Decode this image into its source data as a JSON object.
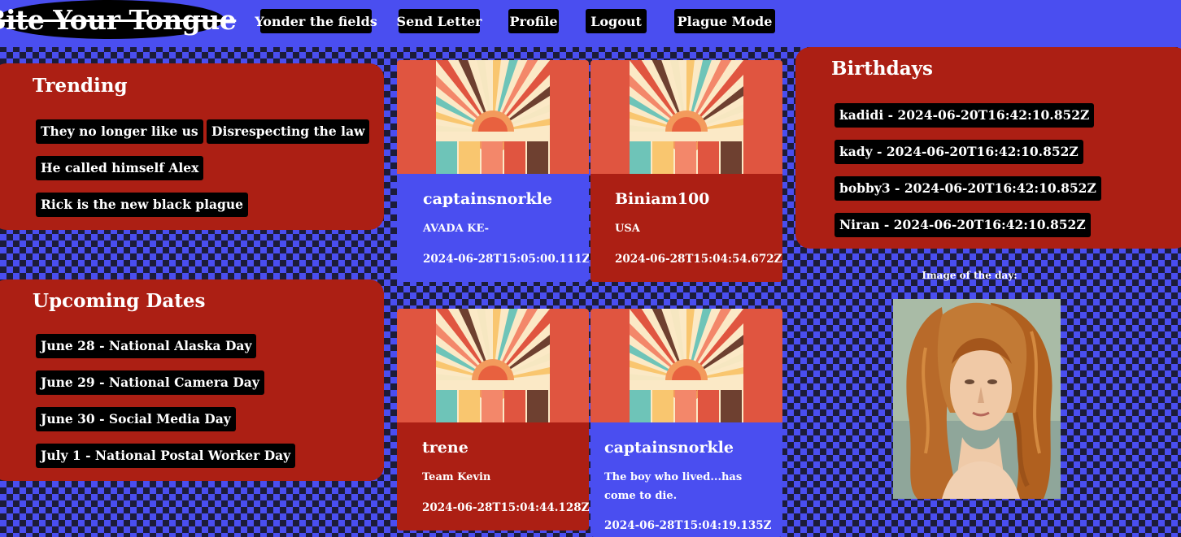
{
  "app": {
    "logo": "Bite Your Tongue"
  },
  "nav": {
    "items": [
      "Yonder the fields",
      "Send Letter",
      "Profile",
      "Logout",
      "Plague Mode"
    ]
  },
  "trending": {
    "title": "Trending",
    "items": [
      "They no longer like us",
      "Disrespecting the law",
      "He called himself Alex",
      "Rick is the new black plague"
    ]
  },
  "upcoming": {
    "title": "Upcoming Dates",
    "items": [
      "June 28 - National Alaska Day",
      "June 29 - National Camera Day",
      "June 30 - Social Media Day",
      "July 1 - National Postal Worker Day"
    ]
  },
  "posts": [
    {
      "user": "captainsnorkle",
      "content": "AVADA KE-",
      "date": "2024-06-28T15:05:00.111Z",
      "color": "#4a4ef0"
    },
    {
      "user": "Biniam100",
      "content": "USA",
      "date": "2024-06-28T15:04:54.672Z",
      "color": "#ac1f14"
    },
    {
      "user": "trene",
      "content": "Team Kevin",
      "date": "2024-06-28T15:04:44.128Z",
      "color": "#ac1f14"
    },
    {
      "user": "captainsnorkle",
      "content": "The boy who lived...has come to die.",
      "date": "2024-06-28T15:04:19.135Z",
      "color": "#4a4ef0"
    }
  ],
  "birthdays": {
    "title": "Birthdays",
    "items": [
      "kadidi - 2024-06-20T16:42:10.852Z",
      "kady - 2024-06-20T16:42:10.852Z",
      "bobby3 - 2024-06-20T16:42:10.852Z",
      "Niran - 2024-06-20T16:42:10.852Z"
    ]
  },
  "image_of_day": {
    "label": "Image of the day:"
  },
  "colors": {
    "blue": "#4a4ef0",
    "red": "#ac1f14",
    "card_image_bg": "#e05540",
    "black": "#000000"
  },
  "icons": [
    "sunburst-palette-image",
    "venus-portrait-image"
  ]
}
